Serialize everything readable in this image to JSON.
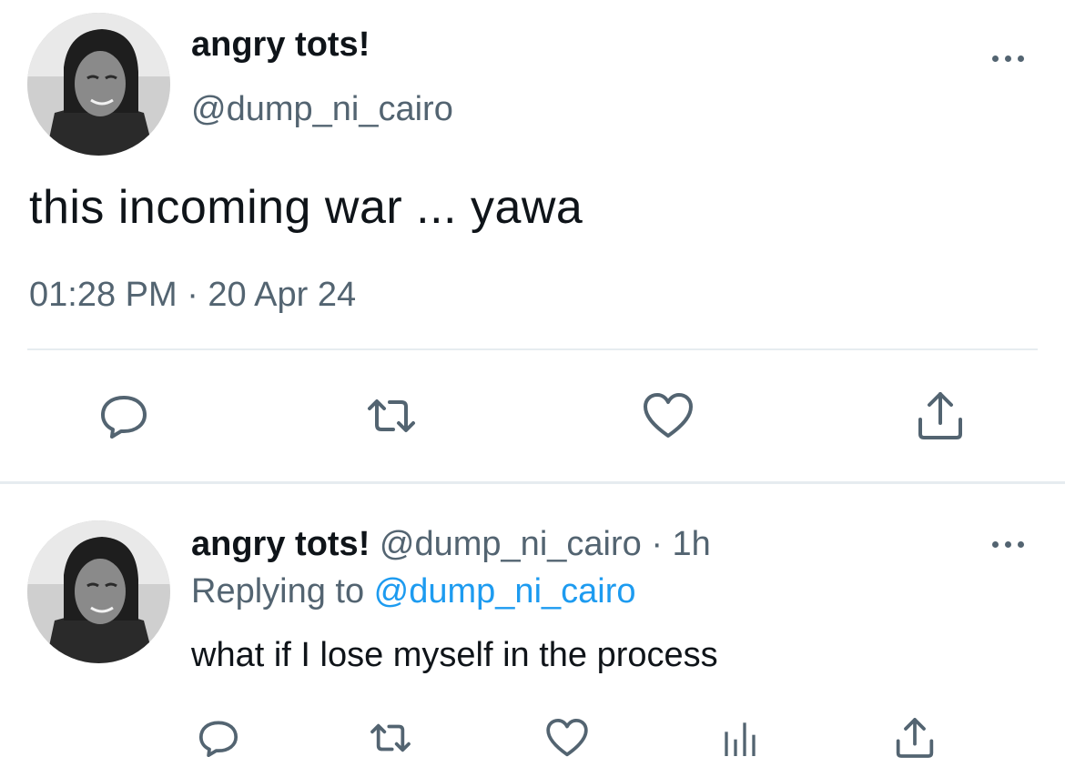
{
  "main_tweet": {
    "avatar_icon": "profile-photo",
    "display_name": "angry tots!",
    "handle": "@dump_ni_cairo",
    "text": "this incoming war ... yawa",
    "timestamp": "01:28 PM · 20 Apr 24",
    "actions": [
      "reply-icon",
      "retweet-icon",
      "like-icon",
      "share-icon"
    ]
  },
  "reply_tweet": {
    "avatar_icon": "profile-photo",
    "display_name": "angry tots!",
    "handle_time": " @dump_ni_cairo · 1h",
    "replying_prefix": "Replying to ",
    "replying_handle": "@dump_ni_cairo",
    "text": "what if I lose myself in the process",
    "actions": [
      "reply-icon",
      "retweet-icon",
      "like-icon",
      "analytics-icon",
      "share-icon"
    ]
  },
  "more_icon": "more-horizontal-icon",
  "colors": {
    "text": "#0f1419",
    "secondary": "#536471",
    "link": "#1d9bf0",
    "divider": "#e6ecf0"
  }
}
